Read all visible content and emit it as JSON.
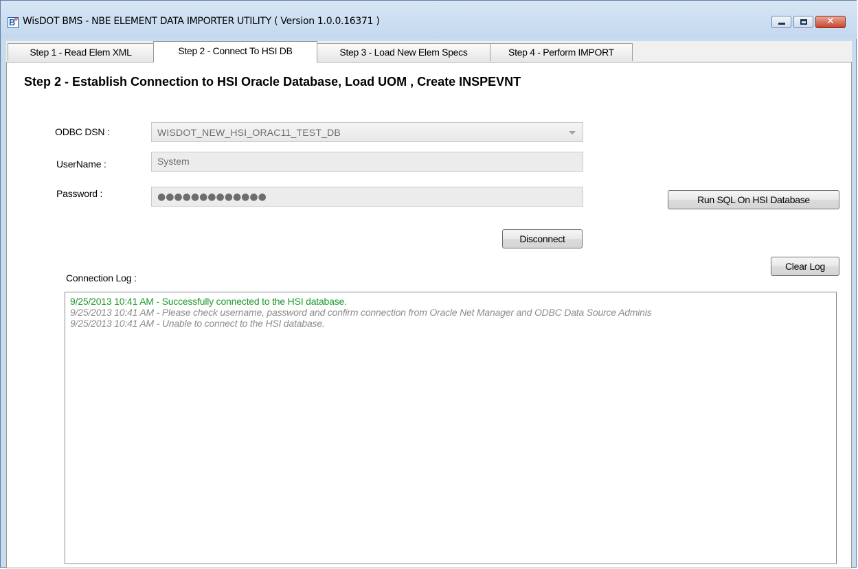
{
  "window": {
    "title": "WisDOT BMS - NBE ELEMENT DATA IMPORTER UTILITY ( Version 1.0.0.16371 )",
    "icon_letter": "B",
    "icon_suffix": "W",
    "icon": "app-icon",
    "controls": {
      "minimize": "minimize-icon",
      "maximize": "maximize-icon",
      "close_glyph": "✕"
    }
  },
  "tabs": [
    {
      "label": "Step 1 - Read Elem XML",
      "active": false
    },
    {
      "label": "Step 2 - Connect To HSI DB",
      "active": true
    },
    {
      "label": "Step 3 - Load New Elem Specs",
      "active": false
    },
    {
      "label": "Step 4 - Perform IMPORT",
      "active": false
    }
  ],
  "page": {
    "heading": "Step 2 - Establish Connection to HSI Oracle Database, Load UOM , Create INSPEVNT",
    "dsn": {
      "label": "ODBC DSN :",
      "value": "WISDOT_NEW_HSI_ORAC11_TEST_DB"
    },
    "username": {
      "label": "UserName :",
      "value": "System"
    },
    "password": {
      "label": "Password :",
      "value": "●●●●●●●●●●●●●"
    },
    "buttons": {
      "run_sql": "Run SQL On HSI Database",
      "disconnect": "Disconnect",
      "clear_log": "Clear Log"
    },
    "log": {
      "label": "Connection Log :",
      "lines": [
        {
          "text": "9/25/2013 10:41 AM - Successfully connected to the HSI database.",
          "kind": "success"
        },
        {
          "text": "9/25/2013 10:41 AM - Please check username, password and confirm connection from Oracle Net Manager and ODBC Data Source Adminis",
          "kind": "warning"
        },
        {
          "text": "9/25/2013 10:41 AM - Unable to connect to the HSI database.",
          "kind": "warning"
        }
      ]
    }
  },
  "colors": {
    "success_text": "#1a9a2a",
    "warning_text": "#8c8c8c",
    "frame": "#c9dbee",
    "close_button": "#c8442e"
  }
}
